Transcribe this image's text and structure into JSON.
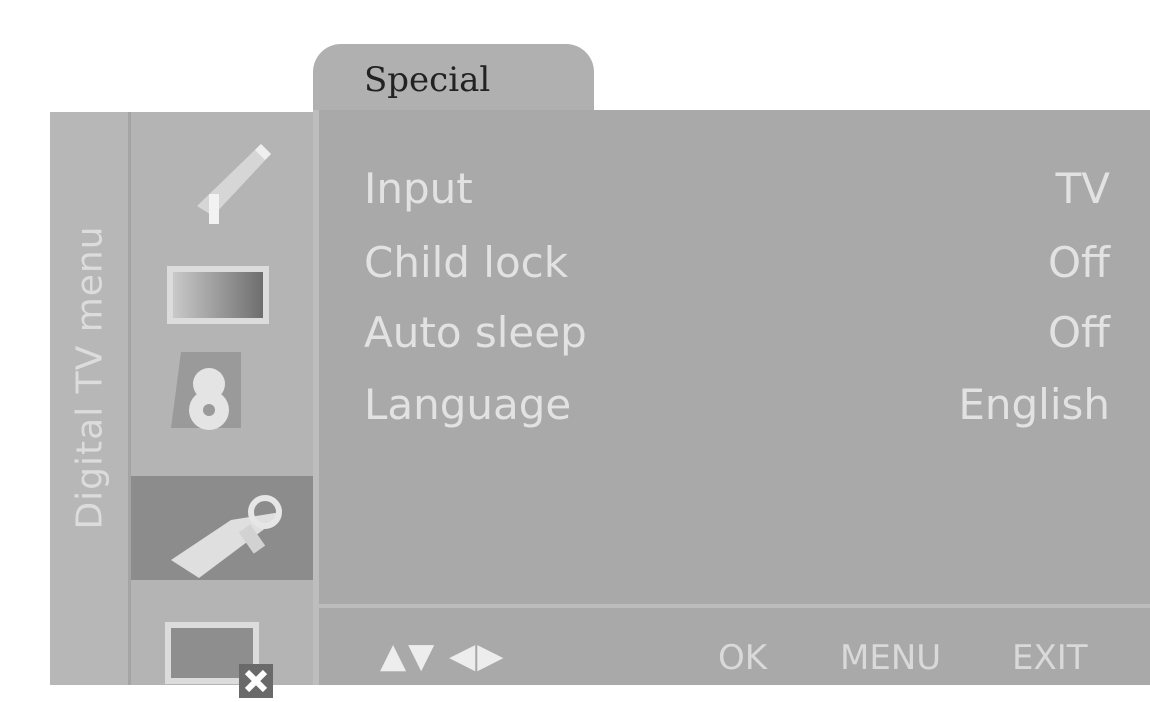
{
  "side_title": "Digital TV menu",
  "icons": [
    {
      "name": "satellite-dish-icon"
    },
    {
      "name": "picture-icon"
    },
    {
      "name": "sound-icon"
    },
    {
      "name": "special-settings-icon",
      "selected": true
    },
    {
      "name": "screen-close-icon"
    }
  ],
  "tab": {
    "label": "Special"
  },
  "menu": {
    "rows": [
      {
        "label": "Input",
        "value": "TV"
      },
      {
        "label": "Child lock",
        "value": "Off"
      },
      {
        "label": "Auto sleep",
        "value": "Off"
      },
      {
        "label": "Language",
        "value": "English"
      }
    ]
  },
  "footer": {
    "nav_glyph": "▲▼ ◀▶",
    "ok": "OK",
    "menu": "MENU",
    "exit": "EXIT"
  }
}
